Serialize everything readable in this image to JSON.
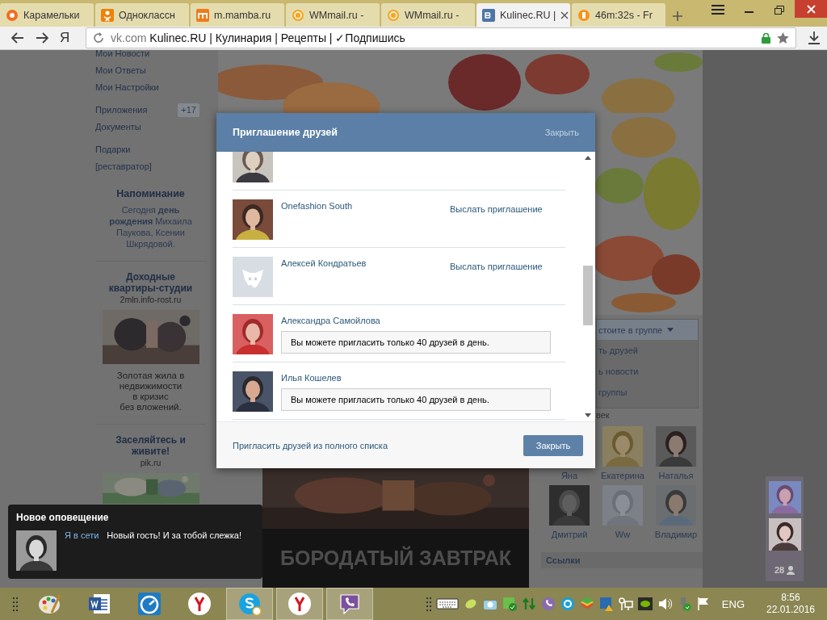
{
  "browser": {
    "tabs": [
      {
        "title": "Карамельки",
        "selected": false
      },
      {
        "title": "Одноклассн",
        "selected": false
      },
      {
        "title": "m.mamba.ru",
        "selected": false
      },
      {
        "title": "WMmail.ru -",
        "selected": false
      },
      {
        "title": "WMmail.ru -",
        "selected": false
      },
      {
        "title": "Kulinec.RU |",
        "selected": true
      },
      {
        "title": "46m:32s - Fr",
        "selected": false
      }
    ],
    "logo": "Я",
    "domain": "vk.com",
    "page_title": "Kulinec.RU | Кулинария | Рецепты | ✓Подпишись"
  },
  "sidebar": {
    "menu_groups": [
      [
        {
          "label": "Мои Новости"
        },
        {
          "label": "Мои Ответы"
        },
        {
          "label": "Мои Настройки"
        }
      ],
      [
        {
          "label": "Приложения",
          "badge": "+17"
        },
        {
          "label": "Документы"
        }
      ],
      [
        {
          "label": "Подарки"
        },
        {
          "label": "[реставратор]"
        }
      ]
    ],
    "reminder": {
      "title": "Напоминание",
      "text": "Сегодня **день рождения** Михаила Паукова, Ксении Шкрядовой."
    },
    "ads": [
      {
        "title": "Доходные квартиры-студии",
        "domain": "2mln.info-rost.ru",
        "text": "Золотая жила в\nнедвижимости\nв кризис\nбез вложений."
      },
      {
        "title": "Заселяйтесь и живите!",
        "domain": "pik.ru"
      }
    ]
  },
  "group_menu": {
    "label": "стоите в группе",
    "items": [
      "ть друзей",
      "ь новости",
      "группы"
    ],
    "members_label": "век"
  },
  "friends": [
    {
      "name": "Яна",
      "photo": false
    },
    {
      "name": "Екатерина",
      "photo": true
    },
    {
      "name": "Наталья",
      "photo": true
    },
    {
      "name": "Дмитрий",
      "photo": true
    },
    {
      "name": "Ww",
      "photo": true
    },
    {
      "name": "Владимир",
      "photo": true
    }
  ],
  "links_header": "Ссылки",
  "video": {
    "caption": "БОРОДАТЫЙ ЗАВТРАК"
  },
  "dialog": {
    "title": "Приглашение друзей",
    "close_link": "Закрыть",
    "rows": [
      {
        "kind": "invite"
      },
      {
        "kind": "invite",
        "name": "Onefashion South",
        "action": "Выслать приглашение"
      },
      {
        "kind": "invite",
        "name": "Алексей Кондратьев",
        "action": "Выслать приглашение",
        "default_avatar": true
      },
      {
        "kind": "limited",
        "name": "Александра Самойлова",
        "message": "Вы можете пригласить только 40 друзей в день."
      },
      {
        "kind": "limited",
        "name": "Илья Кошелев",
        "message": "Вы можете пригласить только 40 друзей в день."
      }
    ],
    "footer_link": "Пригласить друзей из полного списка",
    "button": "Закрыть"
  },
  "notification": {
    "title": "Новое оповещение",
    "status": "Я в сети",
    "text": "Новый гость! И за тобой слежка!"
  },
  "chat_panel": {
    "count": "28"
  },
  "taskbar": {
    "apps": [
      {
        "active": false
      },
      {
        "active": false
      },
      {
        "active": false
      },
      {
        "active": false
      },
      {
        "active": true
      },
      {
        "active": true
      },
      {
        "active": true
      }
    ],
    "language": "ENG",
    "time": "8:56",
    "date": "22.01.2016"
  }
}
